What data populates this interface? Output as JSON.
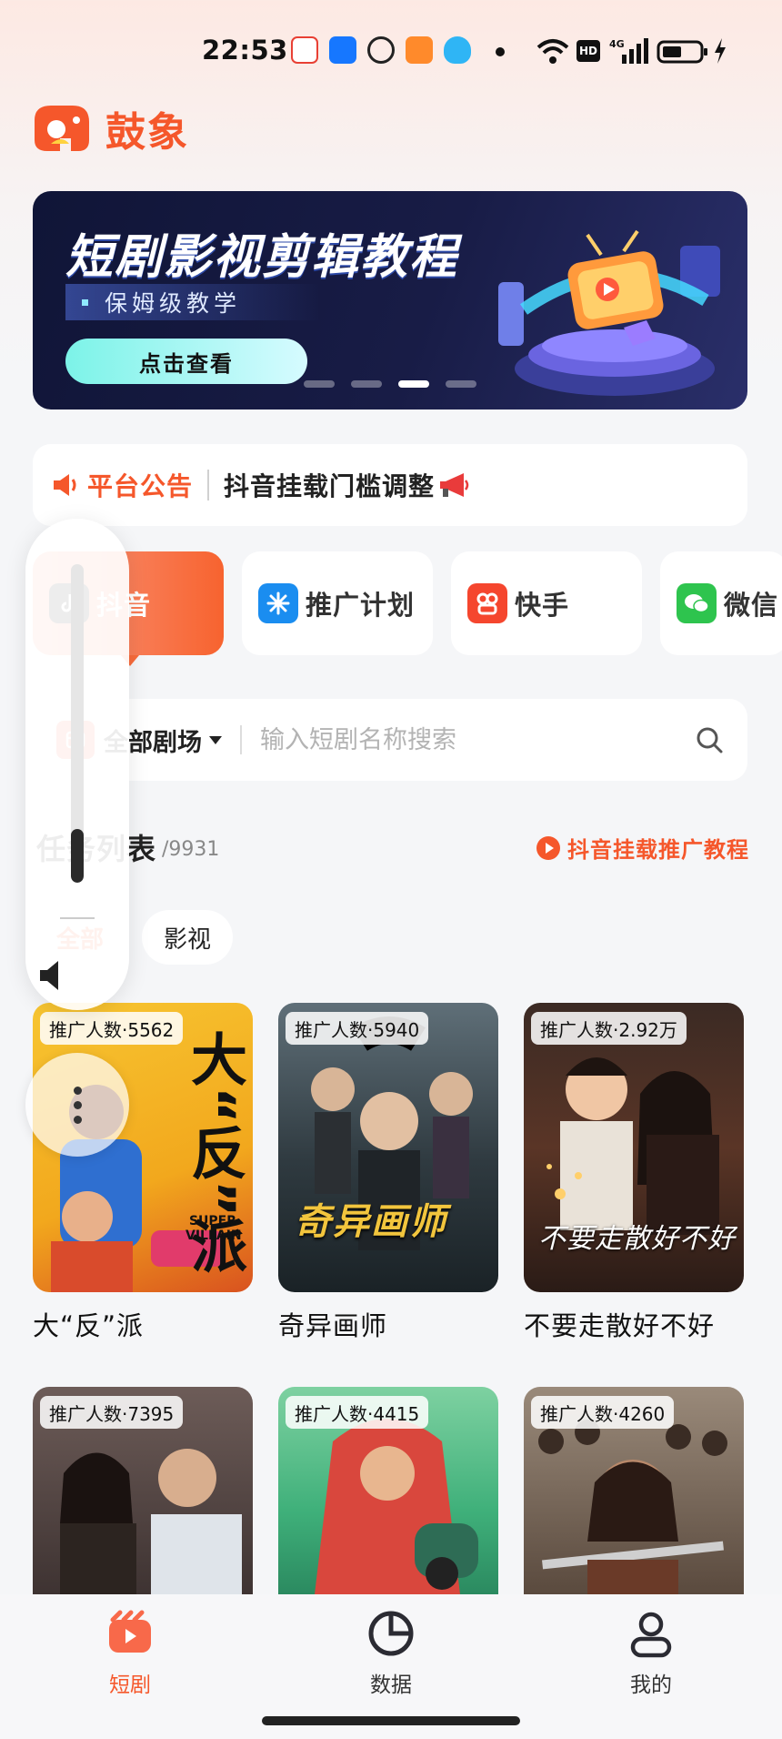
{
  "status_bar": {
    "time": "22:53",
    "network_label": "4G",
    "hd_label": "HD"
  },
  "app": {
    "name": "鼓象"
  },
  "banner": {
    "title": "短剧影视剪辑教程",
    "subtitle": "保姆级教学",
    "button_label": "点击查看",
    "slides_total": 4,
    "slide_active_index": 2
  },
  "notice": {
    "label": "平台公告",
    "text": "抖音挂载门槛调整"
  },
  "platforms": [
    {
      "label": "抖音",
      "icon": "douyin-icon",
      "active": true
    },
    {
      "label": "推广计划",
      "icon": "promo-plan-icon",
      "active": false
    },
    {
      "label": "快手",
      "icon": "kuaishou-icon",
      "active": false
    },
    {
      "label": "微信",
      "icon": "wechat-icon",
      "active": false
    }
  ],
  "search": {
    "theater_label": "全部剧场",
    "placeholder": "输入短剧名称搜索"
  },
  "task_list": {
    "title": "任务列表",
    "count": "/9931",
    "tutorial_link": "抖音挂载推广教程",
    "filters": [
      {
        "label": "全部",
        "active": true
      },
      {
        "label": "影视",
        "active": false
      }
    ]
  },
  "cards": [
    {
      "badge": "推广人数·5562",
      "title": "大“反”派",
      "poster_text": "大“反”派",
      "poster_sub": "SUPER VILLAIN"
    },
    {
      "badge": "推广人数·5940",
      "title": "奇异画师",
      "poster_text": "奇异画师"
    },
    {
      "badge": "推广人数·2.92万",
      "title": "不要走散好不好",
      "poster_text": "不要走散好不好"
    },
    {
      "badge": "推广人数·7395",
      "title": ""
    },
    {
      "badge": "推广人数·4415",
      "title": ""
    },
    {
      "badge": "推广人数·4260",
      "title": ""
    }
  ],
  "volume_overlay": {
    "level": 0.17
  },
  "bottom_nav": [
    {
      "label": "短剧",
      "icon": "short-drama-icon",
      "active": true
    },
    {
      "label": "数据",
      "icon": "pie-chart-icon",
      "active": false
    },
    {
      "label": "我的",
      "icon": "profile-icon",
      "active": false
    }
  ],
  "colors": {
    "accent": "#f5572b",
    "banner_bg": "#141a44",
    "page_bg": "#f5f6f8"
  }
}
